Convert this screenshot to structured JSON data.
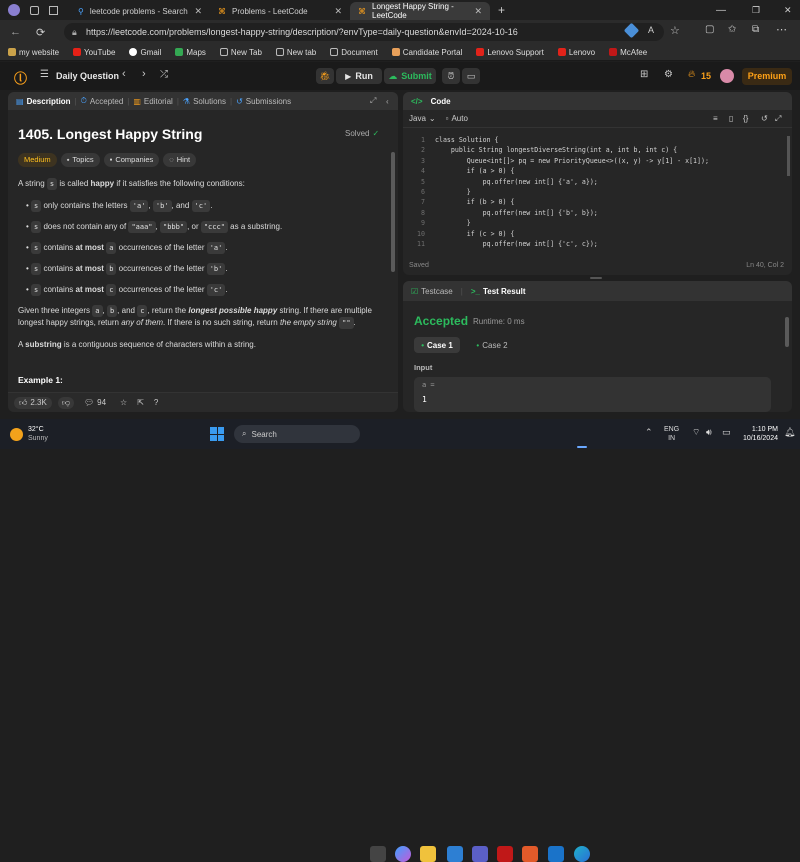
{
  "browser": {
    "tabs": [
      {
        "label": "leetcode problems - Search"
      },
      {
        "label": "Problems - LeetCode"
      },
      {
        "label": "Longest Happy String - LeetCode",
        "active": true
      }
    ],
    "url": "https://leetcode.com/problems/longest-happy-string/description/?envType=daily-question&envId=2024-10-16",
    "bookmarks": [
      "my website",
      "YouTube",
      "Gmail",
      "Maps",
      "New Tab",
      "New tab",
      "Document",
      "Candidate Portal",
      "Lenovo Support",
      "Lenovo",
      "McAfee"
    ]
  },
  "topbar": {
    "section": "Daily Question",
    "run": "Run",
    "submit": "Submit",
    "streak": "15",
    "premium": "Premium"
  },
  "left": {
    "tabs": [
      "Description",
      "Accepted",
      "Editorial",
      "Solutions",
      "Submissions"
    ],
    "title": "1405. Longest Happy String",
    "solved": "Solved",
    "tags": [
      "Medium",
      "Topics",
      "Companies",
      "Hint"
    ],
    "p1_pre": "A string",
    "p1_chip": "s",
    "p1_mid": "is called",
    "p1_bold": "happy",
    "p1_post": "if it satisfies the following conditions:",
    "b1_pre": "only contains the letters",
    "b1_chips": [
      "'a'",
      "'b'",
      "'c'"
    ],
    "b2_post": "does not contain any of",
    "b2_chips": [
      "\"aaa\"",
      "\"bbb\"",
      "\"ccc\""
    ],
    "b2_end": "as a substring.",
    "b3": {
      "pre": "contains",
      "bold": "at most",
      "chip": "a",
      "post": "occurrences of the letter",
      "letter": "'a'"
    },
    "b4": {
      "pre": "contains",
      "bold": "at most",
      "chip": "b",
      "post": "occurrences of the letter",
      "letter": "'b'"
    },
    "b5": {
      "pre": "contains",
      "bold": "at most",
      "chip": "c",
      "post": "occurrences of the letter",
      "letter": "'c'"
    },
    "p2a": "Given three integers",
    "p2b": "and",
    "p2c": ", return the",
    "p2d": "longest possible happy",
    "p2e": "string. If there are multiple",
    "p2f": "longest happy strings, return",
    "p2g": "any of them",
    "p2h": ". If there is no such string, return",
    "p2i": "the empty string",
    "p2j": "\"\"",
    "p3a": "A",
    "p3b": "substring",
    "p3c": "is a contiguous sequence of characters within a string.",
    "example": "Example 1:",
    "likes": "2.3K",
    "comments": "94"
  },
  "code": {
    "header": "Code",
    "lang": "Java",
    "auto": "Auto",
    "saved": "Saved",
    "pos": "Ln 40, Col 2",
    "lines": [
      "class Solution {",
      "    public String longestDiverseString(int a, int b, int c) {",
      "        Queue<int[]> pq = new PriorityQueue<>((x, y) -> y[1] - x[1]);",
      "        if (a > 0) {",
      "            pq.offer(new int[] {'a', a});",
      "        }",
      "        if (b > 0) {",
      "            pq.offer(new int[] {'b', b});",
      "        }",
      "        if (c > 0) {",
      "            pq.offer(new int[] {'c', c});"
    ]
  },
  "result": {
    "tab1": "Testcase",
    "tab2": "Test Result",
    "status": "Accepted",
    "runtime": "Runtime: 0 ms",
    "case1": "Case 1",
    "case2": "Case 2",
    "input": "Input",
    "var": "a =",
    "val": "1"
  },
  "taskbar": {
    "temp": "32°C",
    "weather": "Sunny",
    "search": "Search",
    "lang1": "ENG",
    "lang2": "IN",
    "time": "1:10 PM",
    "date": "10/16/2024"
  }
}
